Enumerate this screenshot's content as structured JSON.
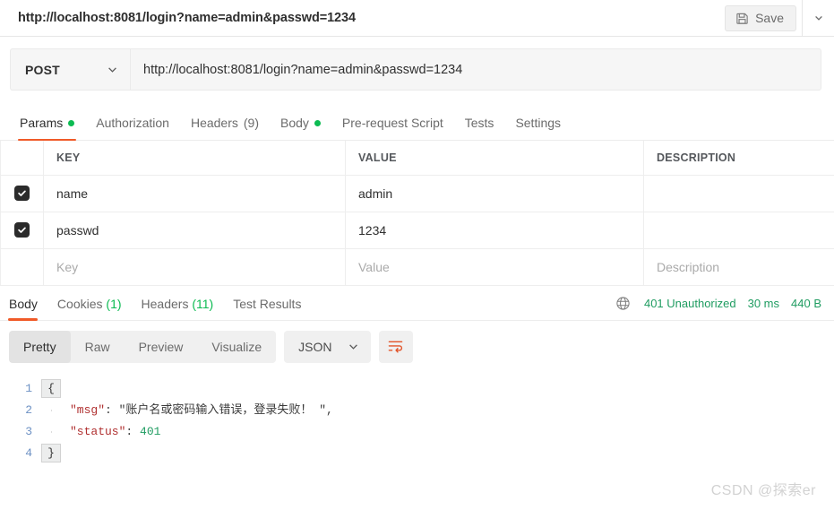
{
  "topbar": {
    "request_title": "http://localhost:8081/login?name=admin&passwd=1234",
    "save_label": "Save",
    "save_icon": "floppy-disk-icon",
    "caret_icon": "chevron-down-icon"
  },
  "urlbar": {
    "method": "POST",
    "method_caret": "chevron-down-icon",
    "url": "http://localhost:8081/login?name=admin&passwd=1234"
  },
  "request_tabs": [
    {
      "label": "Params",
      "dot": true,
      "count": "",
      "active": true
    },
    {
      "label": "Authorization",
      "dot": false,
      "count": "",
      "active": false
    },
    {
      "label": "Headers",
      "dot": false,
      "count": "(9)",
      "active": false
    },
    {
      "label": "Body",
      "dot": true,
      "count": "",
      "active": false
    },
    {
      "label": "Pre-request Script",
      "dot": false,
      "count": "",
      "active": false
    },
    {
      "label": "Tests",
      "dot": false,
      "count": "",
      "active": false
    },
    {
      "label": "Settings",
      "dot": false,
      "count": "",
      "active": false
    }
  ],
  "params_table": {
    "headers": {
      "key": "KEY",
      "value": "VALUE",
      "description": "DESCRIPTION"
    },
    "rows": [
      {
        "checked": true,
        "key": "name",
        "value": "admin",
        "description": ""
      },
      {
        "checked": true,
        "key": "passwd",
        "value": "1234",
        "description": ""
      }
    ],
    "placeholder_row": {
      "key": "Key",
      "value": "Value",
      "description": "Description"
    },
    "check_icon": "checkmark-icon"
  },
  "response_tabs": [
    {
      "label": "Body",
      "count": "",
      "active": true
    },
    {
      "label": "Cookies",
      "count": "(1)",
      "active": false
    },
    {
      "label": "Headers",
      "count": "(11)",
      "active": false
    },
    {
      "label": "Test Results",
      "count": "",
      "active": false
    }
  ],
  "response_meta": {
    "globe_icon": "globe-icon",
    "status": "401 Unauthorized",
    "time": "30 ms",
    "size": "440 B",
    "color": "#1f9c61"
  },
  "response_toolbar": {
    "views": [
      {
        "label": "Pretty",
        "active": true
      },
      {
        "label": "Raw",
        "active": false
      },
      {
        "label": "Preview",
        "active": false
      },
      {
        "label": "Visualize",
        "active": false
      }
    ],
    "format": "JSON",
    "format_caret": "chevron-down-icon",
    "wrap_icon": "word-wrap-icon"
  },
  "response_body": {
    "lines": [
      {
        "num": "1",
        "gutter": "{",
        "gutter_type": "brace",
        "segments": []
      },
      {
        "num": "2",
        "gutter": "",
        "gutter_type": "guide",
        "segments": [
          {
            "t": "    ",
            "c": "k-punc"
          },
          {
            "t": "\"msg\"",
            "c": "k-key"
          },
          {
            "t": ": ",
            "c": "k-punc"
          },
          {
            "t": "\"账户名或密码输入错误，登录失败！ \"",
            "c": "k-str"
          },
          {
            "t": ",",
            "c": "k-punc"
          }
        ]
      },
      {
        "num": "3",
        "gutter": "",
        "gutter_type": "guide",
        "segments": [
          {
            "t": "    ",
            "c": "k-punc"
          },
          {
            "t": "\"status\"",
            "c": "k-key"
          },
          {
            "t": ": ",
            "c": "k-punc"
          },
          {
            "t": "401",
            "c": "k-num"
          }
        ]
      },
      {
        "num": "4",
        "gutter": "}",
        "gutter_type": "brace",
        "segments": []
      }
    ]
  },
  "watermark": "CSDN @探索er"
}
